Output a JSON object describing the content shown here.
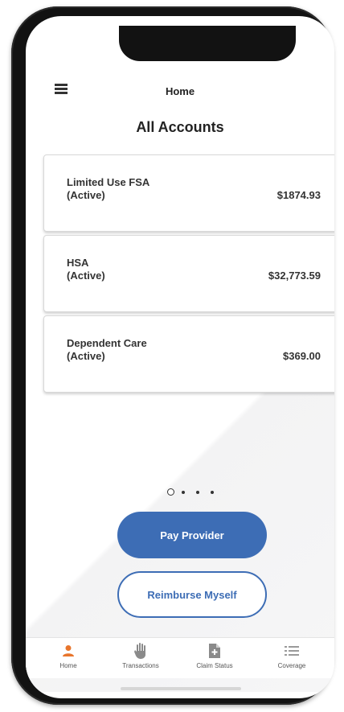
{
  "header": {
    "title": "Home"
  },
  "section_title": "All Accounts",
  "accounts": [
    {
      "name": "Limited Use FSA",
      "status": "(Active)",
      "amount": "$1874.93"
    },
    {
      "name": "HSA",
      "status": "(Active)",
      "amount": "$32,773.59"
    },
    {
      "name": "Dependent Care",
      "status": "(Active)",
      "amount": "$369.00"
    }
  ],
  "pager": {
    "total_pages": 4,
    "current_page": 1
  },
  "actions": {
    "pay_provider": "Pay Provider",
    "reimburse_myself": "Reimburse Myself"
  },
  "tabs": [
    {
      "label": "Home",
      "icon": "person-icon",
      "active": true
    },
    {
      "label": "Transactions",
      "icon": "hand-icon",
      "active": false
    },
    {
      "label": "Claim Status",
      "icon": "document-icon",
      "active": false
    },
    {
      "label": "Coverage",
      "icon": "list-icon",
      "active": false
    }
  ],
  "colors": {
    "accent": "#3d6db5",
    "active_tab": "#e8752c",
    "inactive_tab": "#8a8a8a"
  }
}
